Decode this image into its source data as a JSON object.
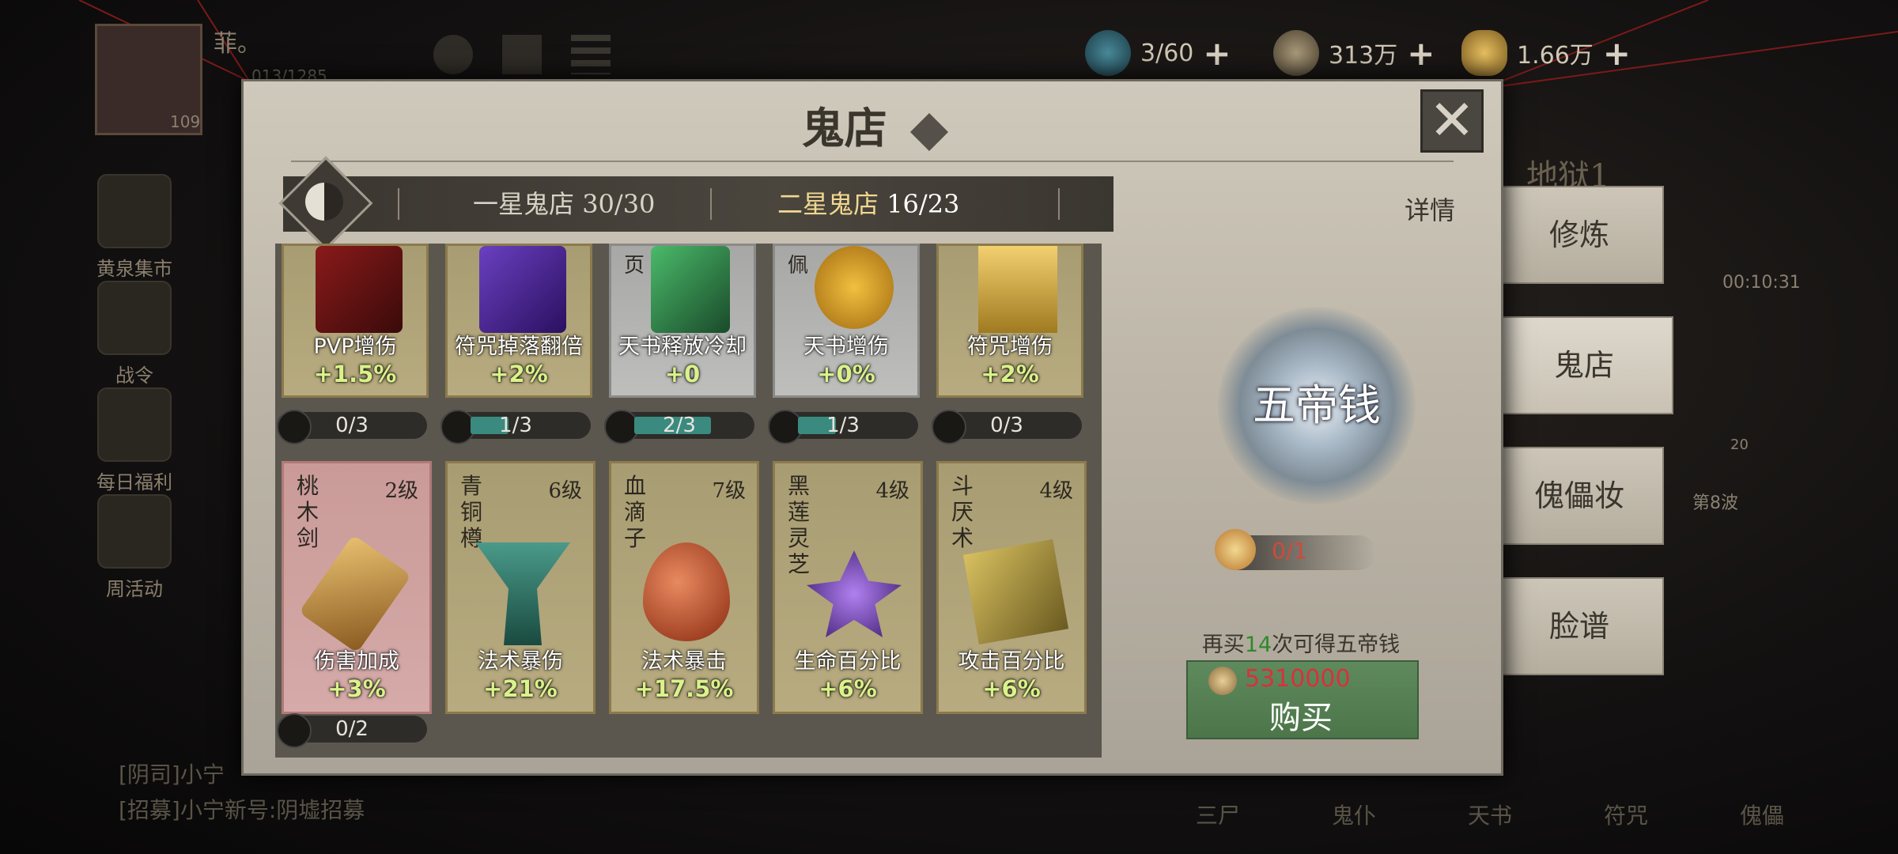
{
  "top_resources": [
    {
      "icon": "jade-orb-icon",
      "value": "3/60"
    },
    {
      "icon": "copper-coin-icon",
      "value": "313万"
    },
    {
      "icon": "gold-ingot-icon",
      "value": "1.66万"
    }
  ],
  "player": {
    "name": "菲。",
    "exp": "013/1285",
    "level": "109"
  },
  "left_menu": [
    "黄泉集市",
    "战令",
    "每日福利",
    "周活动"
  ],
  "right_bg": {
    "title": "地狱1",
    "timer": "00:10:31",
    "count": "20",
    "wave": "第8波"
  },
  "chat": [
    "[阴司]小宁",
    "[招募]小宁新号:阴墟招募"
  ],
  "bottom_nav": [
    "三尸",
    "鬼仆",
    "天书",
    "符咒",
    "傀儡"
  ],
  "dialog": {
    "title": "鬼店",
    "detail_label": "详情",
    "tabs": [
      {
        "label": "一星鬼店",
        "count": "30/30"
      },
      {
        "label": "二星鬼店",
        "count": "16/23"
      }
    ]
  },
  "row1": [
    {
      "name": "PVP增伤",
      "value": "+1.5%",
      "progress": "0/3",
      "fill": 0,
      "style": "gold",
      "label_top": ""
    },
    {
      "name": "符咒掉落翻倍",
      "value": "+2%",
      "progress": "1/3",
      "fill": 0.333,
      "style": "gold",
      "label_top": ""
    },
    {
      "name": "天书释放冷却",
      "value": "+0",
      "progress": "2/3",
      "fill": 0.667,
      "style": "gray",
      "label_top": "页"
    },
    {
      "name": "天书增伤",
      "value": "+0%",
      "progress": "1/3",
      "fill": 0.333,
      "style": "gray",
      "label_top": "佩"
    },
    {
      "name": "符咒增伤",
      "value": "+2%",
      "progress": "0/3",
      "fill": 0,
      "style": "gold",
      "label_top": ""
    }
  ],
  "row2": [
    {
      "vname": "桃木剑",
      "level": "2级",
      "name": "伤害加成",
      "value": "+3%",
      "style": "pink"
    },
    {
      "vname": "青铜樽",
      "level": "6级",
      "name": "法术暴伤",
      "value": "+21%",
      "style": "gold"
    },
    {
      "vname": "血滴子",
      "level": "7级",
      "name": "法术暴击",
      "value": "+17.5%",
      "style": "gold"
    },
    {
      "vname": "黑莲灵芝",
      "level": "4级",
      "name": "生命百分比",
      "value": "+6%",
      "style": "gold"
    },
    {
      "vname": "斗厌术",
      "level": "4级",
      "name": "攻击百分比",
      "value": "+6%",
      "style": "gold"
    }
  ],
  "row2_progress": {
    "value": "0/2",
    "fill": 0
  },
  "reward": {
    "coin_name": "五帝钱",
    "fragment_count": "0/1",
    "hint_prefix": "再买",
    "hint_number": "14",
    "hint_suffix": "次可得五帝钱",
    "price": "5310000",
    "buy_label": "购买"
  },
  "side_tabs": [
    {
      "label": "修炼",
      "active": false
    },
    {
      "label": "鬼店",
      "active": true
    },
    {
      "label": "傀儡妆",
      "active": false
    },
    {
      "label": "脸谱",
      "active": false
    }
  ],
  "colors": {
    "highlight_green": "#2f8a2a",
    "price_red": "#d8313a",
    "value_green": "#d9f28a"
  }
}
